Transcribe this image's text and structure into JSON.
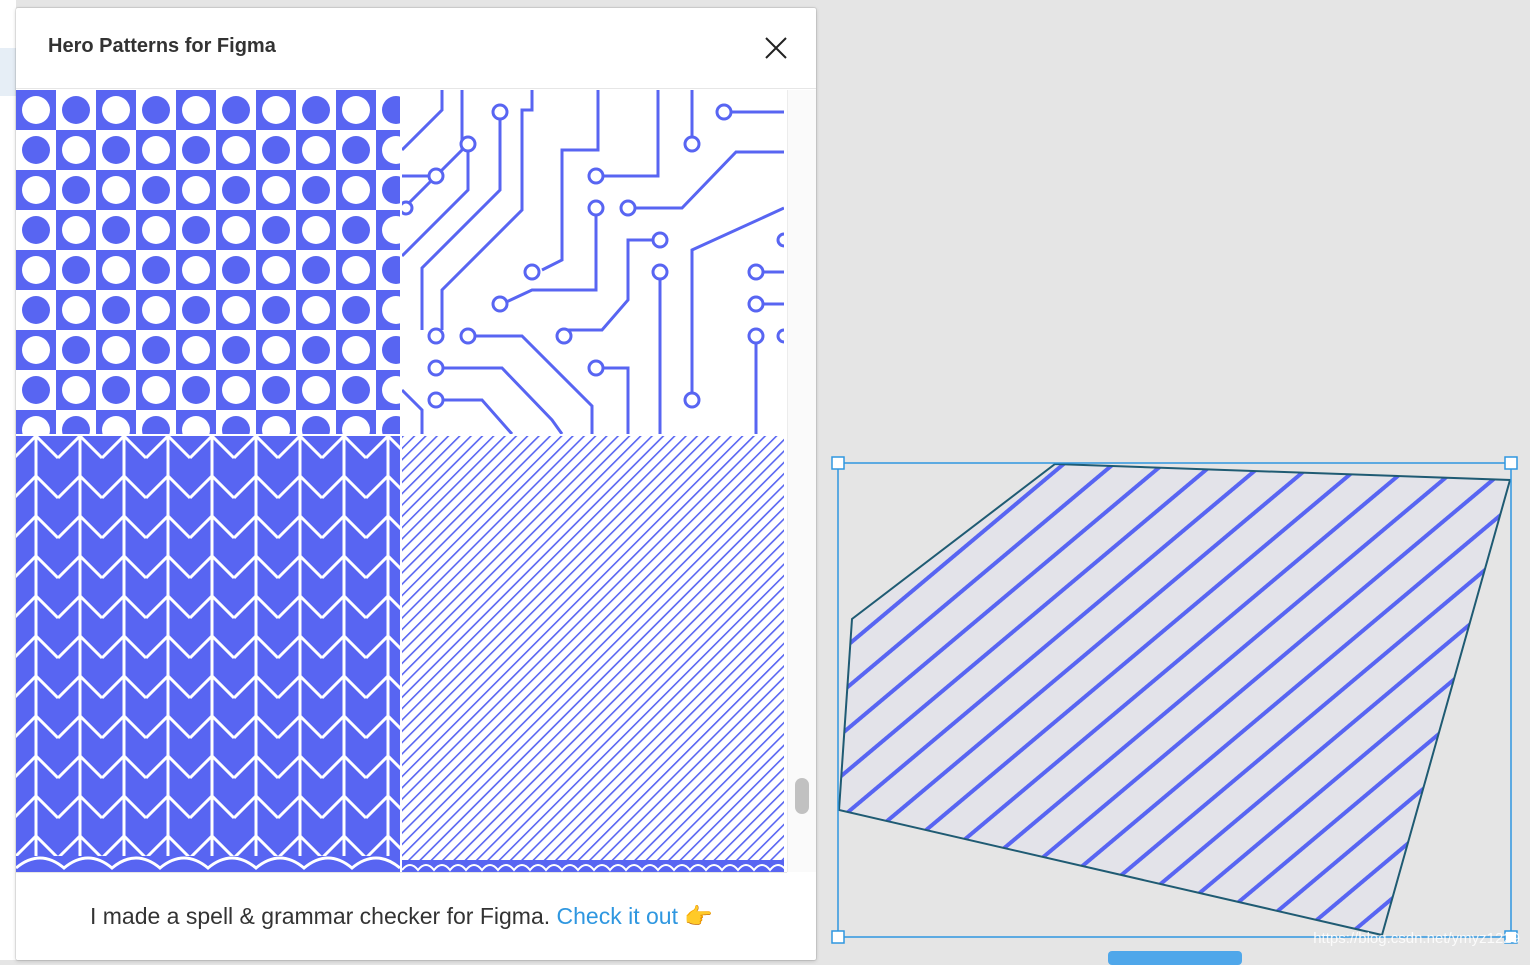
{
  "plugin": {
    "title": "Hero Patterns for Figma",
    "close_icon": "close-icon",
    "patterns": [
      {
        "name": "polka-dots-checkerboard"
      },
      {
        "name": "circuit-board"
      },
      {
        "name": "chevron-herringbone"
      },
      {
        "name": "diagonal-lines"
      }
    ],
    "footer": {
      "text": "I made a spell & grammar checker for Figma.",
      "link_label": "Check it out",
      "emoji": "👉"
    }
  },
  "colors": {
    "pattern_blue": "#5865f2",
    "selection_blue": "#2f97e0",
    "link_blue": "#2f97e0"
  },
  "canvas": {
    "selected_shape": "polygon-with-diagonal-line-fill"
  },
  "watermark": "https://blog.csdn.net/ymyz1229"
}
